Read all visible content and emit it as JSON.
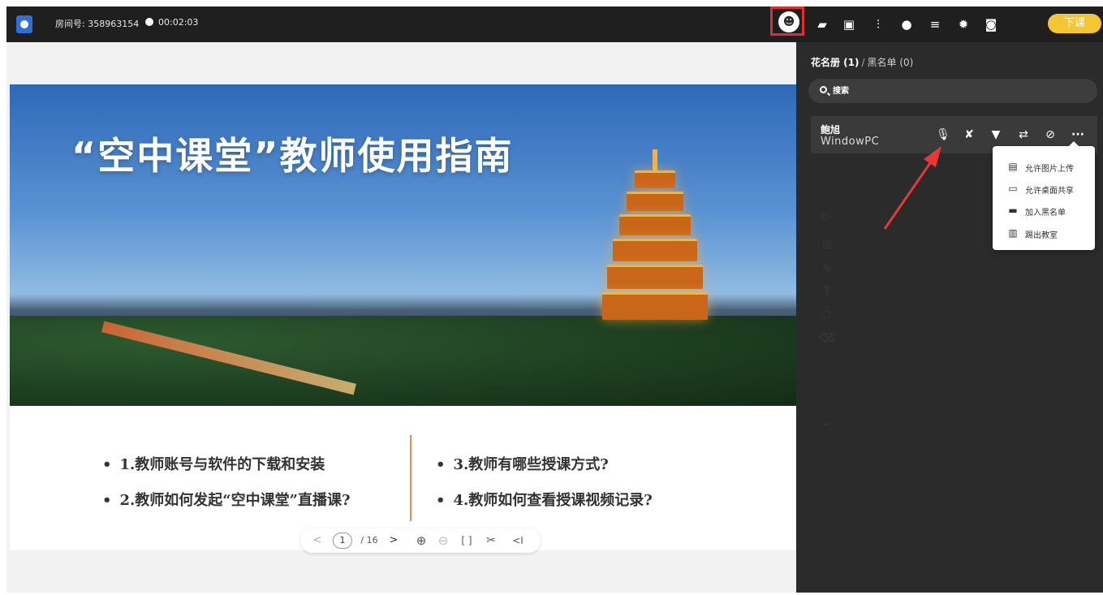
{
  "topbar": {
    "room_label": "房间号: 358963154",
    "timer": "00:02:03",
    "icons": [
      "bolt-icon",
      "roster-icon",
      "folder-icon",
      "toolbox-icon",
      "settings-sliders-icon",
      "chat-icon",
      "list-icon",
      "gear-icon",
      "fullscreen-icon"
    ],
    "end_class_label": "下课",
    "accent_color": "#f4c534",
    "highlight_color": "#e12d2d"
  },
  "slide": {
    "title": "“空中课堂”教师使用指南",
    "bullets": [
      "1.教师账号与软件的下载和安装",
      "2.教师如何发起“空中课堂”直播课?",
      "3.教师有哪些授课方式?",
      "4.教师如何查看授课视频记录?"
    ],
    "divider_color": "#e88d4c"
  },
  "pager": {
    "prev": "<",
    "current_page": "1",
    "total": "/ 16",
    "next": ">",
    "zoom_in": "⊕",
    "zoom_out": "⊖",
    "fit": "[ ]",
    "scissors": "✂",
    "collapse": "<I"
  },
  "sidebar": {
    "roster_tab": "花名册 (1)",
    "separator": "/",
    "blacklist_tab": "黑名单 (0)",
    "search_placeholder": "搜索",
    "user": {
      "name": "鲍旭",
      "device": "WindowPC"
    },
    "user_actions": [
      "mic-off-icon",
      "pen-off-icon",
      "trophy-icon",
      "switch-camera-icon",
      "no-video-icon",
      "more-icon"
    ],
    "menu": [
      {
        "icon": "image-upload-icon",
        "label": "允许图片上传"
      },
      {
        "icon": "screen-share-icon",
        "label": "允许桌面共享"
      },
      {
        "icon": "blacklist-add-icon",
        "label": "加入黑名单"
      },
      {
        "icon": "kick-out-icon",
        "label": "踢出教室"
      }
    ]
  }
}
